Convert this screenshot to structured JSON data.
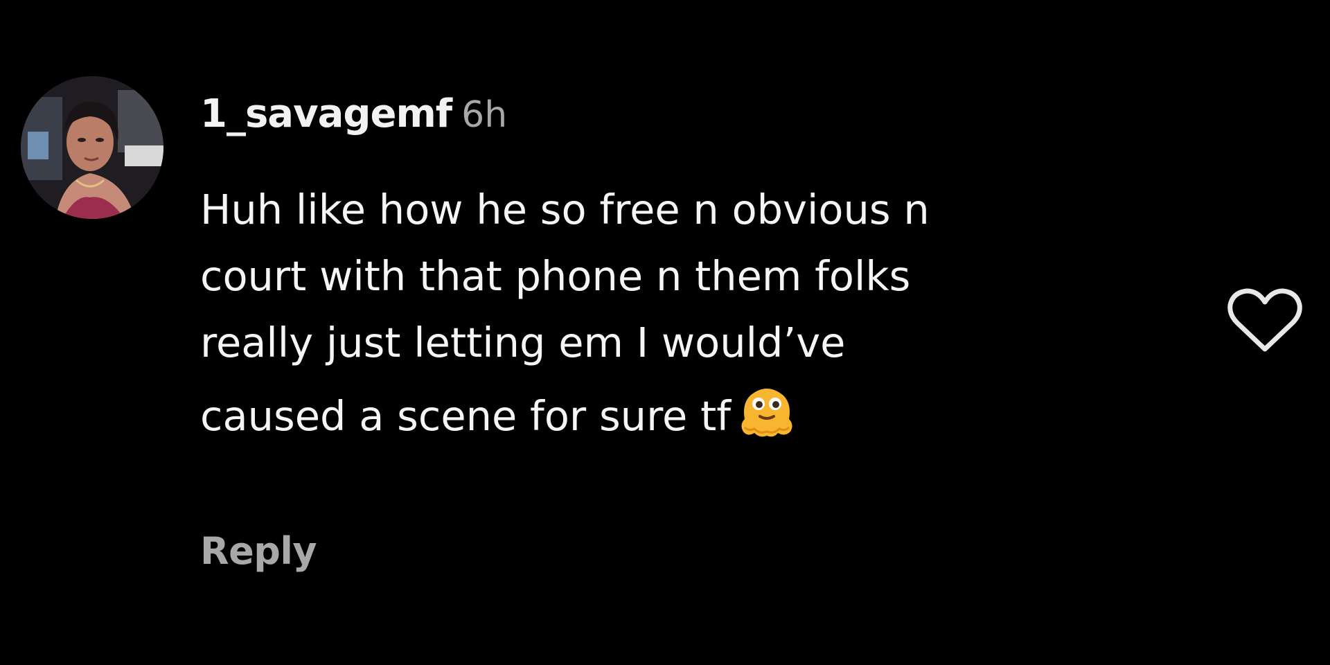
{
  "comment": {
    "username": "1_savagemf",
    "timestamp": "6h",
    "text_lines": [
      "Huh like how he so free n obvious n",
      "court with that phone n them folks",
      "really just letting em I would’ve",
      "caused a scene for sure tf"
    ],
    "trailing_emoji": "melting-face-emoji",
    "reply_label": "Reply"
  },
  "icons": {
    "like": "heart-outline-icon",
    "avatar": "profile-avatar"
  },
  "colors": {
    "background": "#000000",
    "primary_text": "#f5f5f5",
    "secondary_text": "#a8a8a8",
    "emoji": "#f7b530"
  }
}
